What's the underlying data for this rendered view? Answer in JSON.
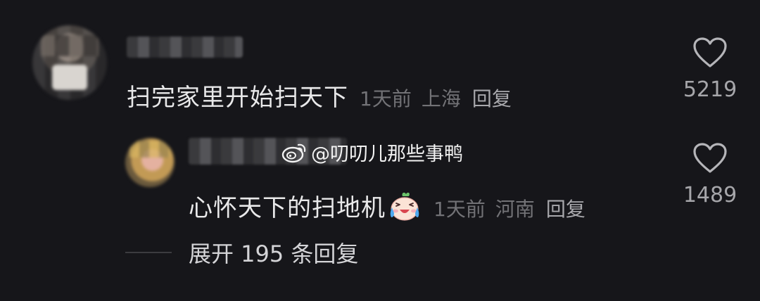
{
  "comment": {
    "text": "扫完家里开始扫天下",
    "time": "1天前",
    "location": "上海",
    "reply_label": "回复",
    "likes": "5219"
  },
  "reply": {
    "text": "心怀天下的扫地机",
    "emoji": "laughing-crying-face-emoji",
    "time": "1天前",
    "location": "河南",
    "reply_label": "回复",
    "likes": "1489"
  },
  "watermark": {
    "icon": "weibo-icon",
    "text": "@叨叨儿那些事鸭"
  },
  "expand": {
    "text": "展开 195 条回复"
  },
  "colors": {
    "background": "#16161a",
    "primary_text": "#e9e9ea",
    "meta_text": "#727276",
    "reply_link": "#a8a8ac"
  }
}
